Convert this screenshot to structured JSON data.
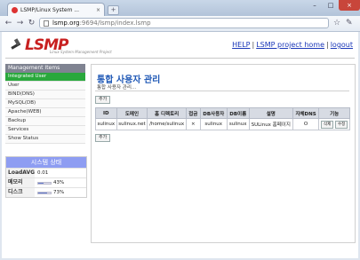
{
  "browser": {
    "tab_title": "LSMP/Linux System ...",
    "tab_close": "×",
    "new_tab": "+",
    "url_host": "lsmp.org",
    "url_path": ":9694/lsmp/index.lsmp",
    "win_min": "–",
    "win_max": "□",
    "win_close": "×"
  },
  "header": {
    "logo_text": "LSMP",
    "logo_sub": "Linux System Management Project",
    "links": [
      "HELP",
      "LSMP project home",
      "logout"
    ],
    "sep": "|"
  },
  "sidebar": {
    "title": "Management Items",
    "items": [
      {
        "label": "Integrated User",
        "active": true
      },
      {
        "label": "User",
        "active": false
      },
      {
        "label": "BIND(DNS)",
        "active": false
      },
      {
        "label": "MySQL(DB)",
        "active": false
      },
      {
        "label": "Apache(WEB)",
        "active": false
      },
      {
        "label": "Backup",
        "active": false
      },
      {
        "label": "Services",
        "active": false
      },
      {
        "label": "Show Status",
        "active": false
      }
    ]
  },
  "system": {
    "title": "시스템 상태",
    "rows": [
      {
        "key": "LoadAVG",
        "value": "0.01",
        "bar": null
      },
      {
        "key": "메모리",
        "value": "43%",
        "bar": 0.43
      },
      {
        "key": "디스크",
        "value": "73%",
        "bar": 0.73
      }
    ]
  },
  "main": {
    "title": "통합 사용자 관리",
    "subtitle": "통합 사용자 관리...",
    "add_label": "추가",
    "columns": [
      "ID",
      "도메인",
      "홈 디렉토리",
      "접금",
      "DB사용자",
      "DB이름",
      "설명",
      "자체DNS",
      "기능"
    ],
    "rows": [
      {
        "id": "sulinux",
        "domain": "sulinux.net",
        "home": "/home/sulinux",
        "lock": "×",
        "dbuser": "sulinux",
        "dbname": "sulinux",
        "desc": "SULinux 홈페이지",
        "dns": "O",
        "delete": "삭제",
        "edit": "수정"
      }
    ]
  },
  "colors": {
    "accent_green": "#29a83c",
    "logo_red": "#c82020",
    "title_blue": "#1e57b5",
    "sys_header": "#8e9df2"
  }
}
